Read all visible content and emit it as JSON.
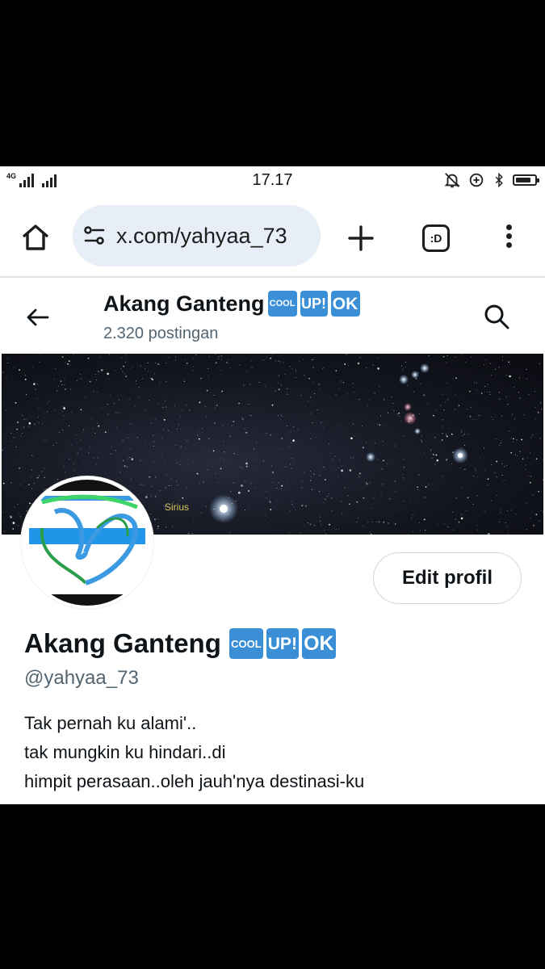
{
  "status_bar": {
    "network": "4G",
    "time": "17.17",
    "battery_level": 0.8
  },
  "browser": {
    "url": "x.com/yahyaa_73",
    "tabs_label": ":D"
  },
  "header": {
    "name": "Akang Ganteng",
    "posts": "2.320 postingan"
  },
  "badges": {
    "cool": "COOL",
    "up": "UP!",
    "ok": "OK"
  },
  "banner": {
    "star_label": "Sirius"
  },
  "profile": {
    "edit_label": "Edit profil",
    "name": "Akang Ganteng",
    "handle": "@yahyaa_73",
    "bio": [
      "Tak pernah ku alami'..",
      "tak mungkin ku hindari..di",
      "himpit perasaan..oleh jauh'nya destinasi-ku"
    ]
  },
  "colors": {
    "badge_blue": "#3a8fd6",
    "muted_text": "#536471",
    "url_bar_bg": "#e8eef7"
  }
}
